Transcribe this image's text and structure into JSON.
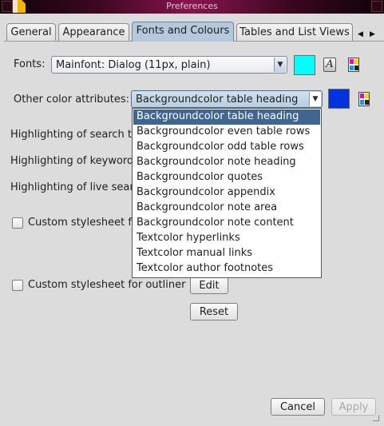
{
  "window": {
    "title": "Preferences"
  },
  "tabs": [
    {
      "label": "General"
    },
    {
      "label": "Appearance"
    },
    {
      "label": "Fonts and Colours",
      "active": true
    },
    {
      "label": "Tables and List Views"
    }
  ],
  "tab_scroll": {
    "left": "◀",
    "right": "▶"
  },
  "fonts_row": {
    "label": "Fonts:",
    "selected": "Mainfont: Dialog (11px, plain)",
    "swatch_color": "#00ffff",
    "font_icon_glyph": "A"
  },
  "color_row": {
    "label": "Other color attributes:",
    "selected": "Backgroundcolor table heading",
    "swatch_color": "#0033dd"
  },
  "dropdown": {
    "options": [
      "Backgroundcolor table heading",
      "Backgroundcolor even table rows",
      "Backgroundcolor odd table rows",
      "Backgroundcolor note heading",
      "Backgroundcolor quotes",
      "Backgroundcolor appendix",
      "Backgroundcolor note area",
      "Backgroundcolor note content",
      "Textcolor hyperlinks",
      "Textcolor manual links",
      "Textcolor author footnotes"
    ],
    "selected_index": 0
  },
  "highlight_labels": {
    "search": "Highlighting of search te",
    "keywords": "Highlighting of keywords",
    "live_search": "Highlighting of live searc"
  },
  "stylesheets": {
    "custom_partial": "Custom stylesheet fo",
    "outliner": "Custom stylesheet for outliner",
    "edit": "Edit",
    "reset": "Reset"
  },
  "buttons": {
    "cancel": "Cancel",
    "apply": "Apply"
  },
  "colors": {
    "accent": "#3e6690",
    "tab_active": "#b6c9dc"
  }
}
